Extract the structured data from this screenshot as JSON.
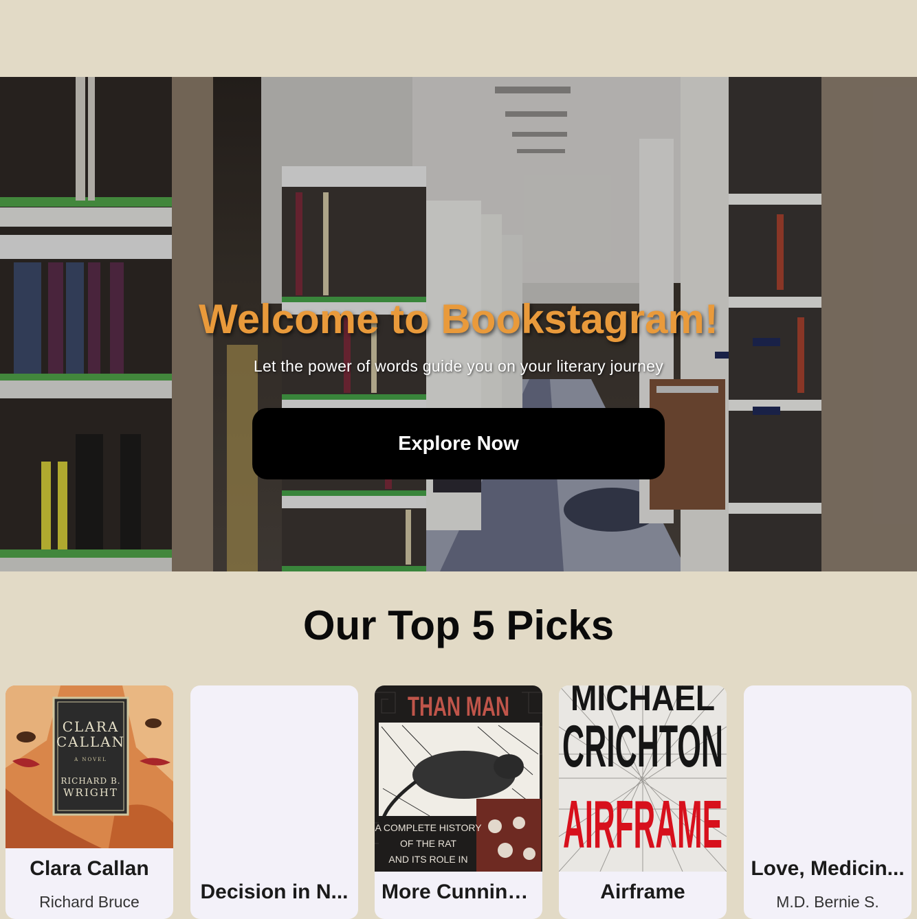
{
  "hero": {
    "title": "Welcome to Bookstagram!",
    "subtitle": "Let the power of words guide you on your literary journey",
    "cta_label": "Explore Now",
    "title_color": "#e99a3b"
  },
  "picks": {
    "heading": "Our Top 5 Picks",
    "books": [
      {
        "title": "Clara Callan",
        "author": "Richard Bruce",
        "cover": "clara-callan-cover",
        "cover_text": {
          "line1": "CLARA",
          "line2": "CALLAN",
          "tag": "A NOVEL",
          "author1": "RICHARD B.",
          "author2": "WRIGHT"
        }
      },
      {
        "title": "Decision in N...",
        "author": "",
        "cover": "none"
      },
      {
        "title": "More Cunning...",
        "author": "",
        "cover": "more-cunning-than-man-cover",
        "cover_text": {
          "top": "THAN MAN",
          "l1": "A COMPLETE HISTORY",
          "l2": "OF THE RAT",
          "l3": "AND ITS ROLE IN"
        }
      },
      {
        "title": "Airframe",
        "author": "",
        "cover": "airframe-cover",
        "cover_text": {
          "top": "MICHAEL",
          "mid": "CRICHTON",
          "big": "AIRFRAME"
        }
      },
      {
        "title": "Love, Medicin...",
        "author": "M.D. Bernie S.",
        "cover": "none"
      }
    ]
  },
  "colors": {
    "background": "#e2dac6",
    "card": "#f3f1f9",
    "button": "#000000"
  }
}
